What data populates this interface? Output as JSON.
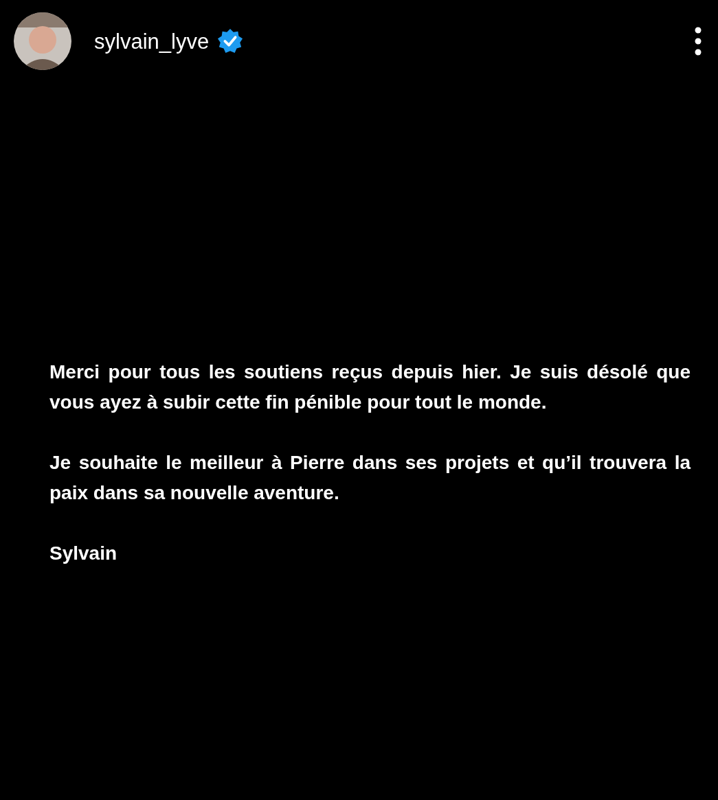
{
  "header": {
    "username": "sylvain_lyve",
    "verified": true
  },
  "post": {
    "paragraphs": [
      "Merci pour tous les soutiens reçus depuis hier. Je suis désolé que vous ayez à subir cette fin pénible pour tout le monde.",
      "Je souhaite le meilleur à Pierre dans ses projets et qu’il trouvera la paix dans sa nouvelle aventure.",
      "Sylvain"
    ]
  }
}
